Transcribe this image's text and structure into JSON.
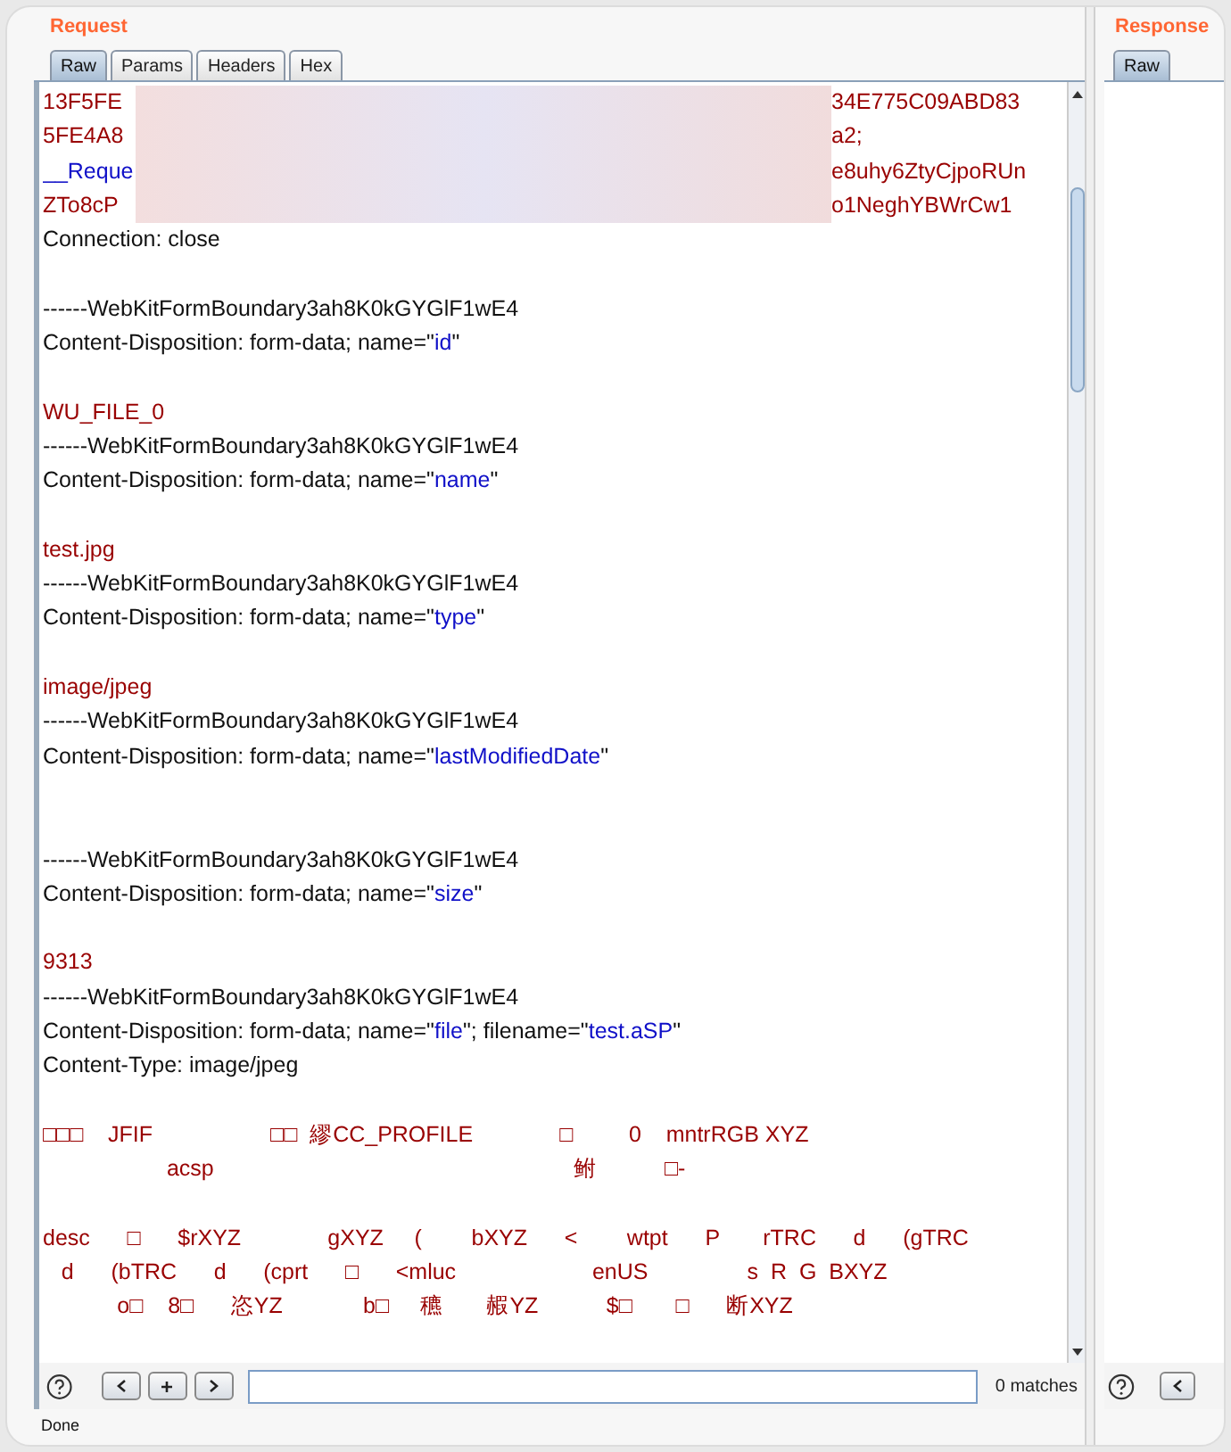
{
  "request": {
    "title": "Request",
    "tabs": [
      {
        "label": "Raw",
        "selected": true
      },
      {
        "label": "Params",
        "selected": false
      },
      {
        "label": "Headers",
        "selected": false
      },
      {
        "label": "Hex",
        "selected": false
      }
    ],
    "lines": [
      {
        "kind": "redacted",
        "start": {
          "kind": "value",
          "text": "13F5FE"
        },
        "end": "34E775C09ABD83"
      },
      {
        "kind": "redacted",
        "start": {
          "kind": "value",
          "text": "5FE4A8"
        },
        "end": "a2;"
      },
      {
        "kind": "redacted",
        "start": {
          "kind": "param",
          "text": "__Reque"
        },
        "end": "e8uhy6ZtyCjpoRUn"
      },
      {
        "kind": "redacted",
        "start": {
          "kind": "value",
          "text": "ZTo8cP"
        },
        "end": "o1NeghYBWrCw1"
      },
      {
        "kind": "text",
        "parts": [
          {
            "kind": "plain",
            "text": "Connection: close"
          }
        ]
      },
      {
        "kind": "blank"
      },
      {
        "kind": "text",
        "parts": [
          {
            "kind": "plain",
            "text": "------WebKitFormBoundary3ah8K0kGYGlF1wE4"
          }
        ]
      },
      {
        "kind": "text",
        "parts": [
          {
            "kind": "plain",
            "text": "Content-Disposition: form-data; name=\""
          },
          {
            "kind": "param",
            "text": "id"
          },
          {
            "kind": "plain",
            "text": "\""
          }
        ]
      },
      {
        "kind": "blank"
      },
      {
        "kind": "text",
        "parts": [
          {
            "kind": "value",
            "text": "WU_FILE_0"
          }
        ]
      },
      {
        "kind": "text",
        "parts": [
          {
            "kind": "plain",
            "text": "------WebKitFormBoundary3ah8K0kGYGlF1wE4"
          }
        ]
      },
      {
        "kind": "text",
        "parts": [
          {
            "kind": "plain",
            "text": "Content-Disposition: form-data; name=\""
          },
          {
            "kind": "param",
            "text": "name"
          },
          {
            "kind": "plain",
            "text": "\""
          }
        ]
      },
      {
        "kind": "blank"
      },
      {
        "kind": "text",
        "parts": [
          {
            "kind": "value",
            "text": "test.jpg"
          }
        ]
      },
      {
        "kind": "text",
        "parts": [
          {
            "kind": "plain",
            "text": "------WebKitFormBoundary3ah8K0kGYGlF1wE4"
          }
        ]
      },
      {
        "kind": "text",
        "parts": [
          {
            "kind": "plain",
            "text": "Content-Disposition: form-data; name=\""
          },
          {
            "kind": "param",
            "text": "type"
          },
          {
            "kind": "plain",
            "text": "\""
          }
        ]
      },
      {
        "kind": "blank"
      },
      {
        "kind": "text",
        "parts": [
          {
            "kind": "value",
            "text": "image/jpeg"
          }
        ]
      },
      {
        "kind": "text",
        "parts": [
          {
            "kind": "plain",
            "text": "------WebKitFormBoundary3ah8K0kGYGlF1wE4"
          }
        ]
      },
      {
        "kind": "text",
        "parts": [
          {
            "kind": "plain",
            "text": "Content-Disposition: form-data; name=\""
          },
          {
            "kind": "param",
            "text": "lastModifiedDate"
          },
          {
            "kind": "plain",
            "text": "\""
          }
        ]
      },
      {
        "kind": "blank"
      },
      {
        "kind": "blank"
      },
      {
        "kind": "text",
        "parts": [
          {
            "kind": "plain",
            "text": "------WebKitFormBoundary3ah8K0kGYGlF1wE4"
          }
        ]
      },
      {
        "kind": "text",
        "parts": [
          {
            "kind": "plain",
            "text": "Content-Disposition: form-data; name=\""
          },
          {
            "kind": "param",
            "text": "size"
          },
          {
            "kind": "plain",
            "text": "\""
          }
        ]
      },
      {
        "kind": "blank"
      },
      {
        "kind": "text",
        "parts": [
          {
            "kind": "value",
            "text": "9313"
          }
        ]
      },
      {
        "kind": "text",
        "parts": [
          {
            "kind": "plain",
            "text": "------WebKitFormBoundary3ah8K0kGYGlF1wE4"
          }
        ]
      },
      {
        "kind": "text",
        "parts": [
          {
            "kind": "plain",
            "text": "Content-Disposition: form-data; name=\""
          },
          {
            "kind": "param",
            "text": "file"
          },
          {
            "kind": "plain",
            "text": "\"; filename=\""
          },
          {
            "kind": "param",
            "text": "test.aSP"
          },
          {
            "kind": "plain",
            "text": "\""
          }
        ]
      },
      {
        "kind": "text",
        "parts": [
          {
            "kind": "plain",
            "text": "Content-Type: image/jpeg"
          }
        ]
      },
      {
        "kind": "blank"
      },
      {
        "kind": "text",
        "parts": [
          {
            "kind": "value",
            "text": "□□□    JFIF                   □□  繆CC_PROFILE              □         0    mntrRGB XYZ"
          }
        ]
      },
      {
        "kind": "text",
        "parts": [
          {
            "kind": "value",
            "text": "                    acsp                                                          鲋           □-"
          }
        ]
      },
      {
        "kind": "blank"
      },
      {
        "kind": "text",
        "parts": [
          {
            "kind": "value",
            "text": "desc      □      $rXYZ              gXYZ     (        bXYZ      <        wtpt      P       rTRC      d      (gTRC"
          }
        ]
      },
      {
        "kind": "text",
        "parts": [
          {
            "kind": "value",
            "text": "   d      (bTRC      d      (cprt      □      <mluc                      enUS                s  R  G  BXYZ"
          }
        ]
      },
      {
        "kind": "text",
        "parts": [
          {
            "kind": "value",
            "text": "            o□    8□      恣YZ             b□     穮       赮YZ           $□       □      断XYZ"
          }
        ]
      }
    ],
    "search": {
      "matches": "0 matches"
    },
    "status": "Done"
  },
  "response": {
    "title": "Response",
    "tabs": [
      {
        "label": "Raw",
        "selected": true
      }
    ]
  }
}
